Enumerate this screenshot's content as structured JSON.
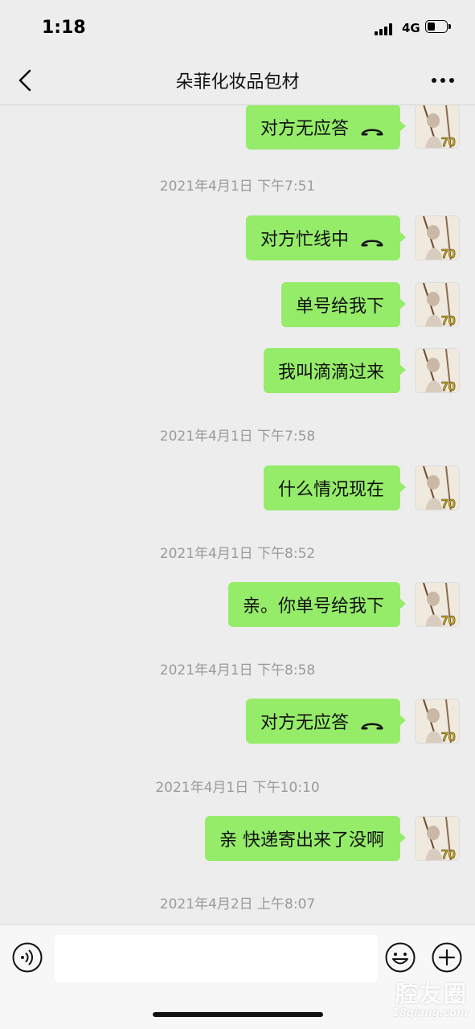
{
  "status_bar": {
    "time": "1:18",
    "network": "4G"
  },
  "nav": {
    "title": "朵菲化妆品包材"
  },
  "messages": [
    {
      "text": "对方无应答",
      "call_icon": "call-ended-icon"
    },
    {
      "timestamp": "2021年4月1日 下午7:51"
    },
    {
      "text": "对方忙线中",
      "call_icon": "call-ended-icon"
    },
    {
      "text": "单号给我下"
    },
    {
      "text": "我叫滴滴过来"
    },
    {
      "timestamp": "2021年4月1日 下午7:58"
    },
    {
      "text": "什么情况现在"
    },
    {
      "timestamp": "2021年4月1日 下午8:52"
    },
    {
      "text": "亲。你单号给我下"
    },
    {
      "timestamp": "2021年4月1日 下午8:58"
    },
    {
      "text": "对方无应答",
      "call_icon": "call-ended-icon"
    },
    {
      "timestamp": "2021年4月1日 下午10:10"
    },
    {
      "text": "亲 快递寄出来了没啊"
    },
    {
      "timestamp": "2021年4月2日 上午8:07"
    }
  ],
  "input_bar": {
    "placeholder": ""
  },
  "watermark": {
    "main": "腔友圈",
    "sub": "18qiang.com"
  },
  "colors": {
    "bubble": "#95ec69",
    "background": "#ededed"
  }
}
